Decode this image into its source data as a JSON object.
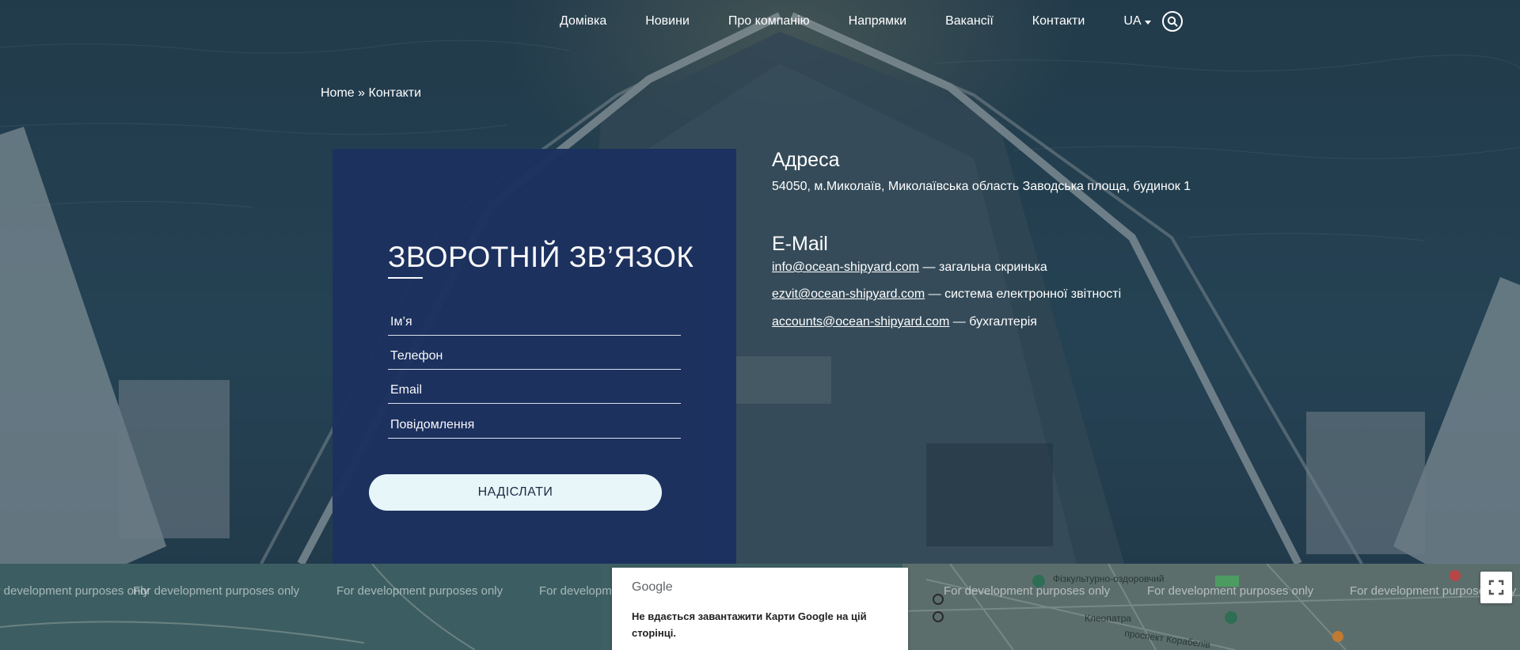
{
  "nav": {
    "items": [
      {
        "label": "Домівка"
      },
      {
        "label": "Новини"
      },
      {
        "label": "Про компанію"
      },
      {
        "label": "Напрямки"
      },
      {
        "label": "Вакансії"
      },
      {
        "label": "Контакти"
      }
    ],
    "lang": "UA"
  },
  "breadcrumb": {
    "home": "Home",
    "separator": "»",
    "current": "Контакти"
  },
  "form": {
    "title": "ЗВОРОТНІЙ ЗВ’ЯЗОК",
    "name_placeholder": "Ім’я",
    "phone_placeholder": "Телефон",
    "email_placeholder": "Email",
    "message_placeholder": "Повідомлення",
    "submit_label": "НАДІСЛАТИ"
  },
  "address": {
    "heading": "Адреса",
    "text": "54050, м.Миколаїв, Миколаївська область Заводська площа, будинок 1"
  },
  "emails": {
    "heading": "E-Mail",
    "items": [
      {
        "address": "info@ocean-shipyard.com",
        "desc": " — загальна скринька"
      },
      {
        "address": "ezvit@ocean-shipyard.com",
        "desc": " — система електронної звітності"
      },
      {
        "address": "accounts@ocean-shipyard.com",
        "desc": " — бухгалтерія"
      }
    ]
  },
  "map": {
    "watermark": "For development purposes only",
    "dialog_logo": "Google",
    "dialog_error": "Не вдається завантажити Карти Google на цій сторінці.",
    "poi_1": "Фізкультурно-оздоровчий",
    "poi_2": "Клеопатра",
    "poi_3": "проспект Корабелів"
  },
  "colors": {
    "card": "#1d3160",
    "button": "#eefcff",
    "map": "#3e5f63"
  }
}
